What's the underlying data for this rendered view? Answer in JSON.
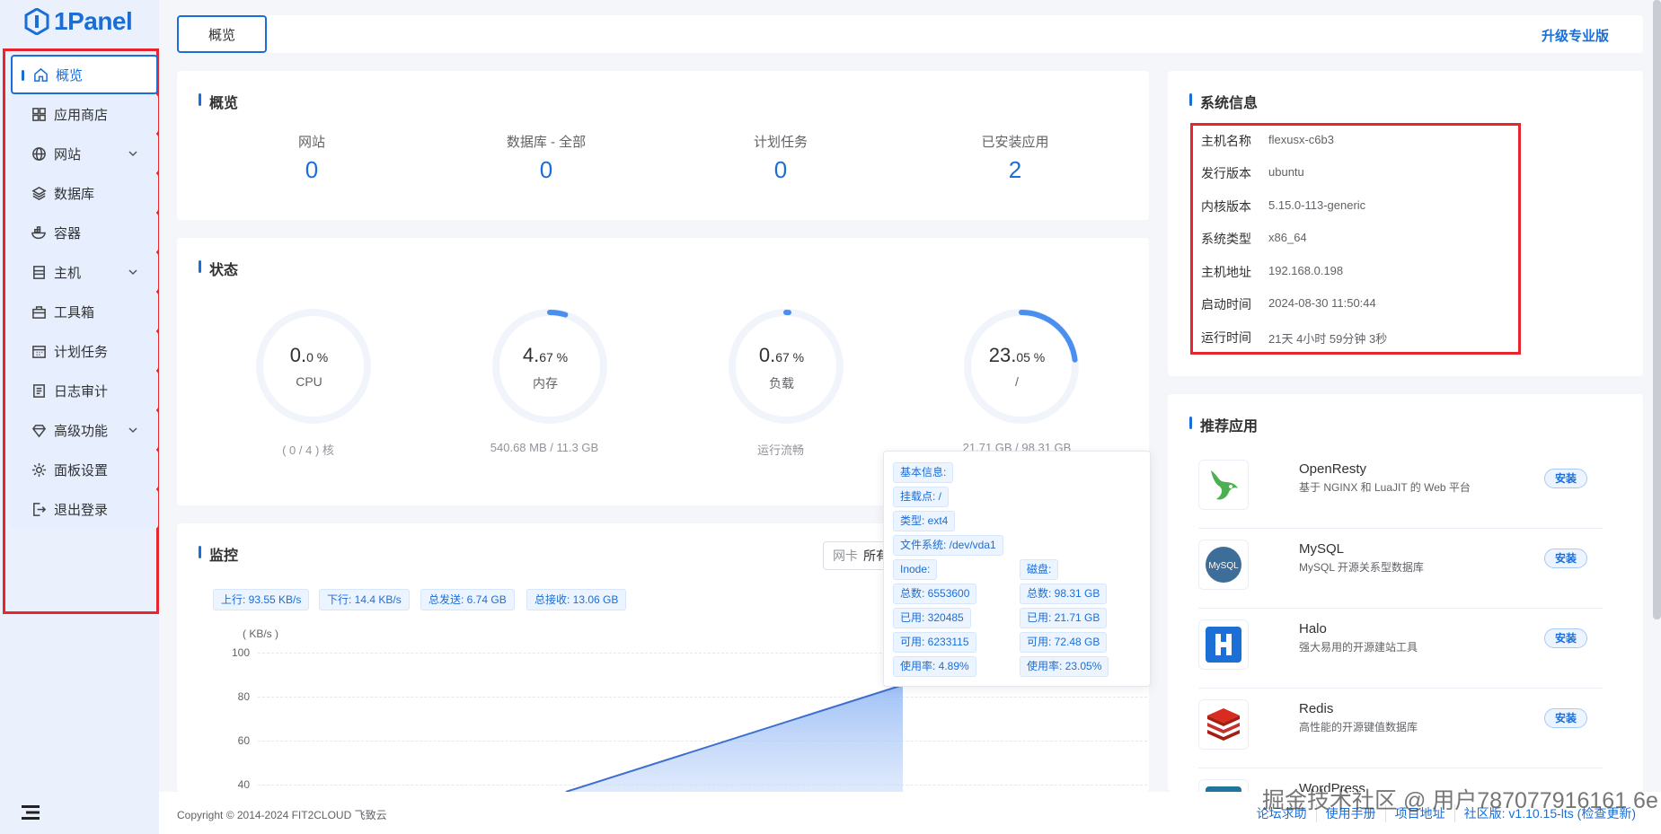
{
  "app": {
    "logo_text": "1Panel"
  },
  "sidebar": {
    "items": [
      {
        "label": "概览",
        "icon": "home-icon"
      },
      {
        "label": "应用商店",
        "icon": "grid-icon"
      },
      {
        "label": "网站",
        "icon": "globe-icon"
      },
      {
        "label": "数据库",
        "icon": "layers-icon"
      },
      {
        "label": "容器",
        "icon": "docker-icon"
      },
      {
        "label": "主机",
        "icon": "server-icon"
      },
      {
        "label": "工具箱",
        "icon": "toolbox-icon"
      },
      {
        "label": "计划任务",
        "icon": "calendar-icon"
      },
      {
        "label": "日志审计",
        "icon": "log-icon"
      },
      {
        "label": "高级功能",
        "icon": "diamond-icon"
      },
      {
        "label": "面板设置",
        "icon": "gear-icon"
      },
      {
        "label": "退出登录",
        "icon": "logout-icon"
      }
    ]
  },
  "topbar": {
    "tab_label": "概览",
    "upgrade_label": "升级专业版"
  },
  "overview": {
    "title": "概览",
    "stats": [
      {
        "label": "网站",
        "value": "0"
      },
      {
        "label": "数据库 - 全部",
        "value": "0"
      },
      {
        "label": "计划任务",
        "value": "0"
      },
      {
        "label": "已安装应用",
        "value": "2"
      }
    ]
  },
  "status": {
    "title": "状态",
    "gauges": [
      {
        "int": "0.",
        "dec": "0 %",
        "name": "CPU",
        "sub": "( 0 / 4 ) 核",
        "percent": 0
      },
      {
        "int": "4.",
        "dec": "67 %",
        "name": "内存",
        "sub": "540.68 MB / 11.3 GB",
        "percent": 4.67
      },
      {
        "int": "0.",
        "dec": "67 %",
        "name": "负载",
        "sub": "运行流畅",
        "percent": 0.67
      },
      {
        "int": "23.",
        "dec": "05 %",
        "name": "/",
        "sub": "21.71 GB / 98.31 GB",
        "percent": 23.05
      }
    ]
  },
  "monitor": {
    "title": "监控",
    "filter_placeholder": "网卡",
    "filter_value": "所有",
    "tags": [
      "上行: 93.55 KB/s",
      "下行: 14.4 KB/s",
      "总发送: 6.74 GB",
      "总接收: 13.06 GB"
    ],
    "y_unit": "( KB/s )",
    "y_ticks": [
      "100",
      "80",
      "60",
      "40"
    ]
  },
  "tooltip": {
    "basic": "基本信息:",
    "mount": "挂载点: /",
    "type": "类型: ext4",
    "fs": "文件系统: /dev/vda1",
    "inode_label": "Inode:",
    "disk_label": "磁盘:",
    "inode_total": "总数: 6553600",
    "inode_used": "已用: 320485",
    "inode_free": "可用: 6233115",
    "inode_usage": "使用率: 4.89%",
    "disk_total": "总数: 98.31 GB",
    "disk_used": "已用: 21.71 GB",
    "disk_free": "可用: 72.48 GB",
    "disk_usage": "使用率: 23.05%"
  },
  "system": {
    "title": "系统信息",
    "rows": [
      {
        "key": "主机名称",
        "value": "flexusx-c6b3"
      },
      {
        "key": "发行版本",
        "value": "ubuntu"
      },
      {
        "key": "内核版本",
        "value": "5.15.0-113-generic"
      },
      {
        "key": "系统类型",
        "value": "x86_64"
      },
      {
        "key": "主机地址",
        "value": "192.168.0.198"
      },
      {
        "key": "启动时间",
        "value": "2024-08-30 11:50:44"
      },
      {
        "key": "运行时间",
        "value": "21天 4小时 59分钟 3秒"
      }
    ]
  },
  "apps": {
    "title": "推荐应用",
    "install_label": "安装",
    "items": [
      {
        "name": "OpenResty",
        "desc": "基于 NGINX 和 LuaJIT 的 Web 平台"
      },
      {
        "name": "MySQL",
        "desc": "MySQL 开源关系型数据库"
      },
      {
        "name": "Halo",
        "desc": "强大易用的开源建站工具"
      },
      {
        "name": "Redis",
        "desc": "高性能的开源键值数据库"
      },
      {
        "name": "WordPress",
        "desc": ""
      }
    ]
  },
  "footer": {
    "copyright": "Copyright © 2014-2024 FIT2CLOUD 飞致云",
    "links": [
      "论坛求助",
      "使用手册",
      "项目地址",
      "社区版: v1.10.15-lts (检查更新)"
    ],
    "watermark": "掘金技术社区 @ 用户787077916161 6e"
  },
  "colors": {
    "accent": "#1a6ed8",
    "highlight_border": "#e6262c",
    "sidebar_bg": "#eaf1fc"
  }
}
